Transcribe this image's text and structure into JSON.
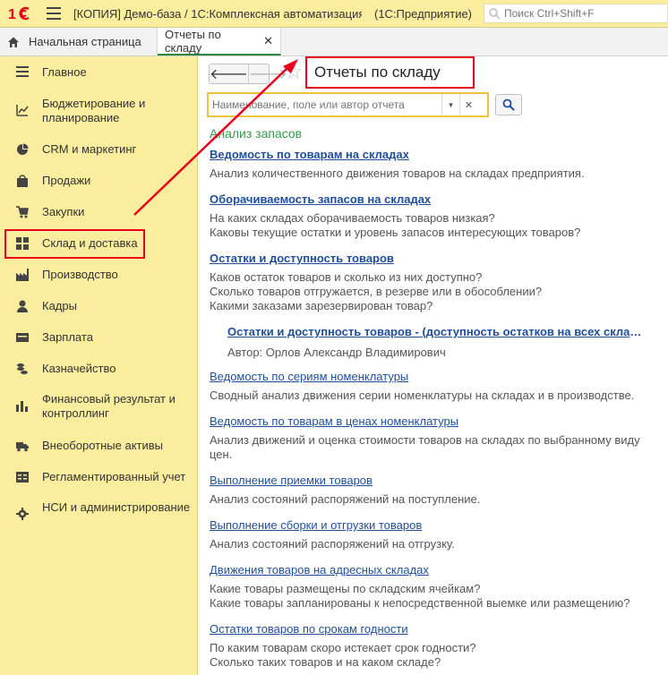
{
  "titlebar": {
    "title": "[КОПИЯ] Демо-база / 1С:Комплексная автоматизация",
    "mode": "(1С:Предприятие)",
    "search_placeholder": "Поиск Ctrl+Shift+F",
    "colors": {
      "bar": "#fbed9e",
      "logo": "#e8001c"
    }
  },
  "tabs": [
    {
      "label": "Начальная страница",
      "icon": "home-icon"
    },
    {
      "label": "Отчеты по складу",
      "active": true
    }
  ],
  "sidebar": {
    "items": [
      {
        "label": "Главное",
        "icon": "menu-lines-icon"
      },
      {
        "label": "Бюджетирование и планирование",
        "icon": "chart-trend-icon"
      },
      {
        "label": "CRM и маркетинг",
        "icon": "pie-chart-icon"
      },
      {
        "label": "Продажи",
        "icon": "shopping-bag-icon"
      },
      {
        "label": "Закупки",
        "icon": "cart-icon"
      },
      {
        "label": "Склад и доставка",
        "icon": "warehouse-grid-icon",
        "highlighted": true
      },
      {
        "label": "Производство",
        "icon": "factory-icon"
      },
      {
        "label": "Кадры",
        "icon": "person-icon"
      },
      {
        "label": "Зарплата",
        "icon": "wallet-icon"
      },
      {
        "label": "Казначейство",
        "icon": "coins-icon"
      },
      {
        "label": "Финансовый результат и контроллинг",
        "icon": "bar-chart-icon"
      },
      {
        "label": "Внеоборотные активы",
        "icon": "truck-icon"
      },
      {
        "label": "Регламентированный учет",
        "icon": "ledger-icon"
      },
      {
        "label": "НСИ и администрирование",
        "icon": "gear-icon"
      }
    ]
  },
  "main": {
    "heading": "Отчеты по складу",
    "filter_placeholder": "Наименование, поле или автор отчета",
    "section": "Анализ запасов",
    "reports": [
      {
        "title": "Ведомость по товарам на складах",
        "bold": true,
        "desc": [
          "Анализ количественного движения товаров на складах предприятия."
        ]
      },
      {
        "title": "Оборачиваемость запасов на складах",
        "bold": true,
        "desc": [
          "На каких складах оборачиваемость товаров низкая?",
          "Каковы текущие остатки и уровень запасов интересующих товаров?"
        ]
      },
      {
        "title": "Остатки и доступность товаров",
        "bold": true,
        "desc": [
          "Каков остаток товаров и сколько из них доступно?",
          "Сколько товаров отгружается, в резерве или в обособлении?",
          "Какими заказами зарезервирован товар?"
        ]
      },
      {
        "title": "Остатки и доступность товаров - (доступность остатков на всех складах)",
        "bold": true,
        "sub": true,
        "author": "Автор: Орлов Александр Владимирович"
      },
      {
        "title": "Ведомость по сериям номенклатуры",
        "desc": [
          "Сводный анализ движения серии номенклатуры на складах и в производстве."
        ]
      },
      {
        "title": "Ведомость по товарам в ценах номенклатуры",
        "desc": [
          "Анализ движений и оценка стоимости товаров на складах по выбранному виду",
          "цен."
        ]
      },
      {
        "title": "Выполнение приемки товаров",
        "desc": [
          "Анализ состояний распоряжений на поступление."
        ]
      },
      {
        "title": "Выполнение сборки и отгрузки товаров",
        "desc": [
          "Анализ состояний распоряжений на отгрузку."
        ]
      },
      {
        "title": "Движения товаров на адресных складах",
        "desc": [
          "Какие товары размещены по складским ячейкам?",
          "Какие товары запланированы к непосредственной выемке или размещению?"
        ]
      },
      {
        "title": "Остатки товаров по срокам годности",
        "desc": [
          "По каким товарам скоро истекает срок годности?",
          "Сколько таких товаров и на каком складе?"
        ]
      }
    ]
  },
  "annotation_color": "#e8001c"
}
